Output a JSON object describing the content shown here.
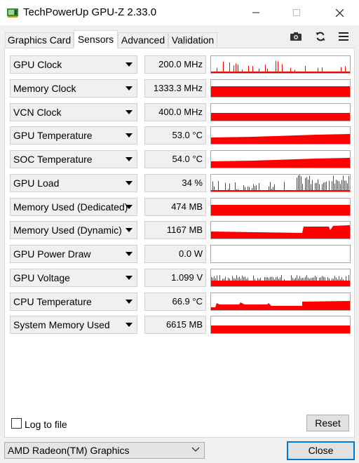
{
  "window": {
    "title": "TechPowerUp GPU-Z 2.33.0"
  },
  "tabs": [
    {
      "label": "Graphics Card"
    },
    {
      "label": "Sensors"
    },
    {
      "label": "Advanced"
    },
    {
      "label": "Validation"
    }
  ],
  "toolbar": {
    "icons": [
      "camera-icon",
      "refresh-icon",
      "menu-icon"
    ]
  },
  "sensors": [
    {
      "name": "GPU Clock",
      "value": "200.0 MHz",
      "graph": "spikes-sparse"
    },
    {
      "name": "Memory Clock",
      "value": "1333.3 MHz",
      "graph": "full-high"
    },
    {
      "name": "VCN Clock",
      "value": "400.0 MHz",
      "graph": "full-mid"
    },
    {
      "name": "GPU Temperature",
      "value": "53.0 °C",
      "graph": "rising-mid"
    },
    {
      "name": "SOC Temperature",
      "value": "54.0 °C",
      "graph": "rising-mid"
    },
    {
      "name": "GPU Load",
      "value": "34 %",
      "graph": "spikes-dense"
    },
    {
      "name": "Memory Used (Dedicated)",
      "value": "474 MB",
      "graph": "full-high"
    },
    {
      "name": "Memory Used (Dynamic)",
      "value": "1167 MB",
      "graph": "step-up"
    },
    {
      "name": "GPU Power Draw",
      "value": "0.0 W",
      "graph": "empty"
    },
    {
      "name": "GPU Voltage",
      "value": "1.099 V",
      "graph": "voltage"
    },
    {
      "name": "CPU Temperature",
      "value": "66.9 °C",
      "graph": "cpu-temp"
    },
    {
      "name": "System Memory Used",
      "value": "6615 MB",
      "graph": "full-mid"
    }
  ],
  "footer": {
    "log_label": "Log to file",
    "log_checked": false,
    "reset_label": "Reset",
    "gpu_selected": "AMD Radeon(TM) Graphics",
    "close_label": "Close"
  },
  "colors": {
    "graph": "#ff0000",
    "focus_border": "#0078d7"
  }
}
